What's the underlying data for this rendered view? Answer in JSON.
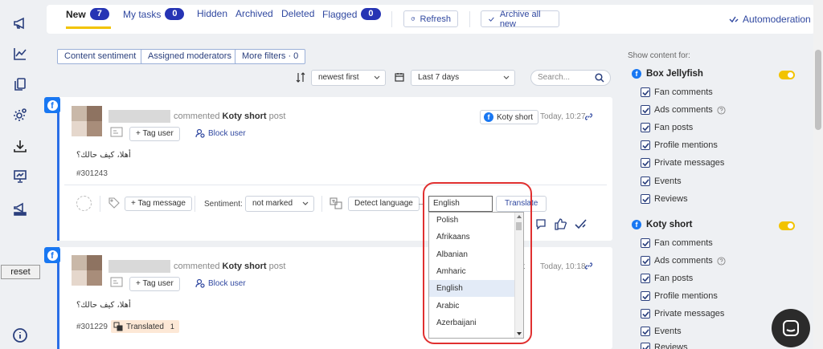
{
  "tabs": [
    {
      "label": "New",
      "count": "7"
    },
    {
      "label": "My tasks",
      "count": "0"
    },
    {
      "label": "Hidden"
    },
    {
      "label": "Archived"
    },
    {
      "label": "Deleted"
    },
    {
      "label": "Flagged",
      "count": "0"
    }
  ],
  "toolbar": {
    "refresh": "Refresh",
    "archive_all": "Archive all new",
    "automoderation": "Automoderation"
  },
  "filters": {
    "content_sentiment": "Content sentiment",
    "assigned_moderators": "Assigned moderators",
    "more_filters": "More filters · 0",
    "sort_value": "newest first",
    "date_value": "Last 7 days",
    "search_placeholder": "Search..."
  },
  "sidebar": {
    "reset": "reset"
  },
  "posts": [
    {
      "action": "commented",
      "page": "Koty short",
      "object": "post",
      "page_tag": "Koty short",
      "time": "Today, 10:27",
      "tag_user": "+ Tag user",
      "block_user": "Block user",
      "text": "أهلا، كيف حالك؟",
      "id": "#301243",
      "tag_message": "+ Tag message",
      "sentiment_label": "Sentiment:",
      "sentiment_value": "not marked",
      "detect_language": "Detect language",
      "language_input": "English",
      "translate": "Translate"
    },
    {
      "action": "commented",
      "page": "Koty short",
      "object": "post",
      "time": "Today, 10:18",
      "tag_user": "+ Tag user",
      "block_user": "Block user",
      "text": "أهلا، كيف حالك؟",
      "id": "#301229",
      "translated_label": "Translated",
      "translated_count": "1",
      "page_tag_partial": "t"
    }
  ],
  "language_options": [
    "Polish",
    "Afrikaans",
    "Albanian",
    "Amharic",
    "English",
    "Arabic",
    "Azerbaijani"
  ],
  "language_selected": "English",
  "right_panel": {
    "title": "Show content for:",
    "pages": [
      {
        "name": "Box Jellyfish",
        "enabled": true,
        "options": [
          "Fan comments",
          "Ads comments",
          "Fan posts",
          "Profile mentions",
          "Private messages",
          "Events",
          "Reviews"
        ]
      },
      {
        "name": "Koty short",
        "enabled": true,
        "options": [
          "Fan comments",
          "Ads comments",
          "Fan posts",
          "Profile mentions",
          "Private messages",
          "Events",
          "Reviews"
        ]
      }
    ]
  },
  "colors": {
    "accent": "#2634b4",
    "tab_underline": "#f2c300",
    "facebook": "#1877f2",
    "highlight_ring": "#e03030"
  }
}
